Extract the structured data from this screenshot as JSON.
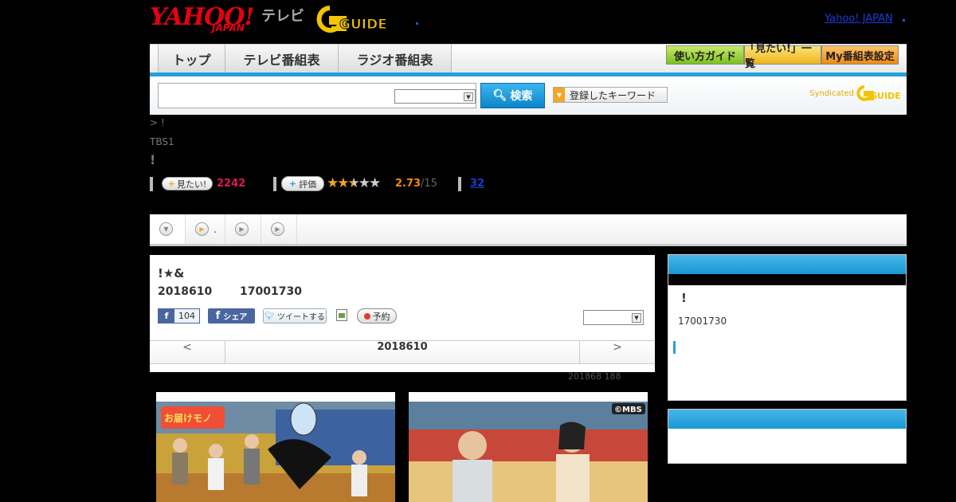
{
  "header": {
    "yahoo_logo": "YAHOO!",
    "yahoo_logo_sub": "JAPAN",
    "tv_label": "テレビ",
    "gguide_logo": "GUIDE",
    "yahoo_japan_link": "Yahoo! JAPAN"
  },
  "nav": {
    "tabs": [
      {
        "label": "トップ"
      },
      {
        "label": "テレビ番組表"
      },
      {
        "label": "ラジオ番組表"
      }
    ],
    "right_buttons": [
      {
        "label": "使い方ガイド",
        "color": "#7cc01e"
      },
      {
        "label": "「見たい!」一覧",
        "color": "#f0b31b"
      },
      {
        "label": "My番組表設定",
        "color": "#f28b0d"
      }
    ],
    "accent": "#23a1d9"
  },
  "search": {
    "input_value": "",
    "select_value": "",
    "button_label": "検索",
    "keyword_button_label": "登録したキーワード",
    "syndicated_label": "Syndicated",
    "syndicated_logo": "GUIDE"
  },
  "program": {
    "breadcrumb": "> !",
    "station": "TBS1",
    "title": "!",
    "mitai_label": "見たい!",
    "mitai_count": "2242",
    "hyoka_label": "評価",
    "rating": "2.73",
    "rating_max": "/15",
    "rating_stars": 2.5,
    "comment_count": "32"
  },
  "subtabs": [
    {
      "label": ""
    },
    {
      "label": "."
    },
    {
      "label": ""
    },
    {
      "label": ""
    }
  ],
  "episode": {
    "title": "!★&",
    "date": "2018610",
    "time": "17001730",
    "fb_like_count": "104",
    "fb_share_label": "シェア",
    "tweet_label": "ツイートする",
    "reserve_label": "予約",
    "select_value": "",
    "day_prev": "<",
    "day_current": "2018610",
    "day_next": ">",
    "updated_text": "201868  188"
  },
  "photos": [
    {
      "caption_mark": "お届けモノ",
      "channel_mark": ""
    },
    {
      "caption_mark": "",
      "channel_mark": "©MBS"
    }
  ],
  "sidebar": {
    "box1": {
      "title": "!",
      "time": "17001730"
    },
    "box2": {}
  }
}
